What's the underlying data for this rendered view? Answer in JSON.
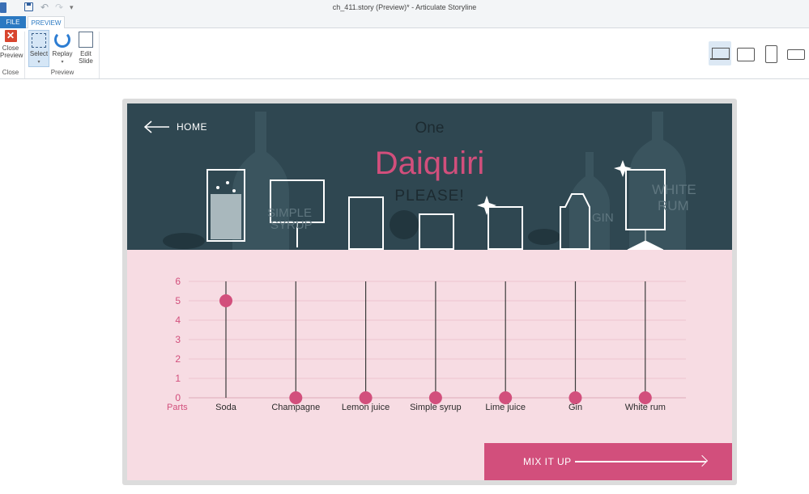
{
  "window": {
    "title": "ch_411.story (Preview)* -  Articulate Storyline"
  },
  "tabs": [
    {
      "label": "FILE"
    },
    {
      "label": "PREVIEW"
    }
  ],
  "ribbon": {
    "close_group": {
      "button_label": "Close Preview",
      "group_label": "Close"
    },
    "preview_group": {
      "select_label": "Select",
      "replay_label": "Replay",
      "edit_label": "Edit Slide",
      "group_label": "Preview"
    },
    "devices": [
      "desktop-icon",
      "tablet-landscape-icon",
      "tablet-portrait-icon",
      "phone-landscape-icon"
    ]
  },
  "slide": {
    "home_label": "HOME",
    "title_top": "One",
    "title_main": "Daiquiri",
    "title_bottom": "PLEASE!",
    "bottle_labels": {
      "syrup_1": "SIMPLE",
      "syrup_2": "SYRUP",
      "gin": "GIN",
      "rum_1": "WHITE",
      "rum_2": "RUM"
    },
    "colors": {
      "banner": "#2f4751",
      "accent": "#d24f7c",
      "panel": "#f7dce3"
    },
    "chart_data": {
      "type": "scatter",
      "xlabel": "",
      "ylabel": "Parts",
      "ylim": [
        0,
        6
      ],
      "yticks": [
        "0",
        "1",
        "2",
        "3",
        "4",
        "5",
        "6"
      ],
      "categories": [
        "Soda",
        "Champagne",
        "Lemon juice",
        "Simple syrup",
        "Lime juice",
        "Gin",
        "White rum"
      ],
      "values": [
        5,
        0,
        0,
        0,
        0,
        0,
        0
      ]
    },
    "mix_button": {
      "label": "MIX IT UP"
    }
  }
}
